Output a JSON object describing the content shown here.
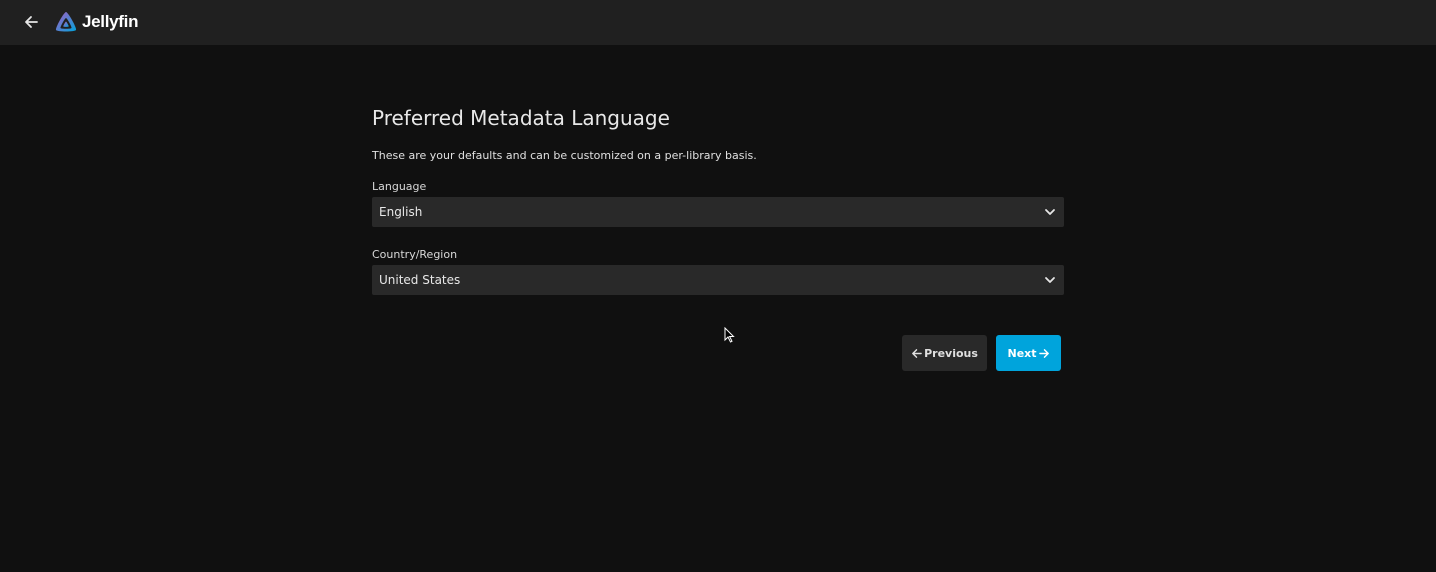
{
  "header": {
    "back_icon": "arrow-left-icon",
    "logo_icon": "jellyfin-triangle-icon",
    "logo_text": "Jellyfin"
  },
  "wizard": {
    "title": "Preferred Metadata Language",
    "description": "These are your defaults and can be customized on a per-library basis.",
    "language": {
      "label": "Language",
      "value": "English"
    },
    "country": {
      "label": "Country/Region",
      "value": "United States"
    },
    "previous_label": "Previous",
    "next_label": "Next"
  },
  "colors": {
    "background": "#101010",
    "header": "#202020",
    "select_bg": "#292929",
    "accent": "#00a4dc"
  }
}
